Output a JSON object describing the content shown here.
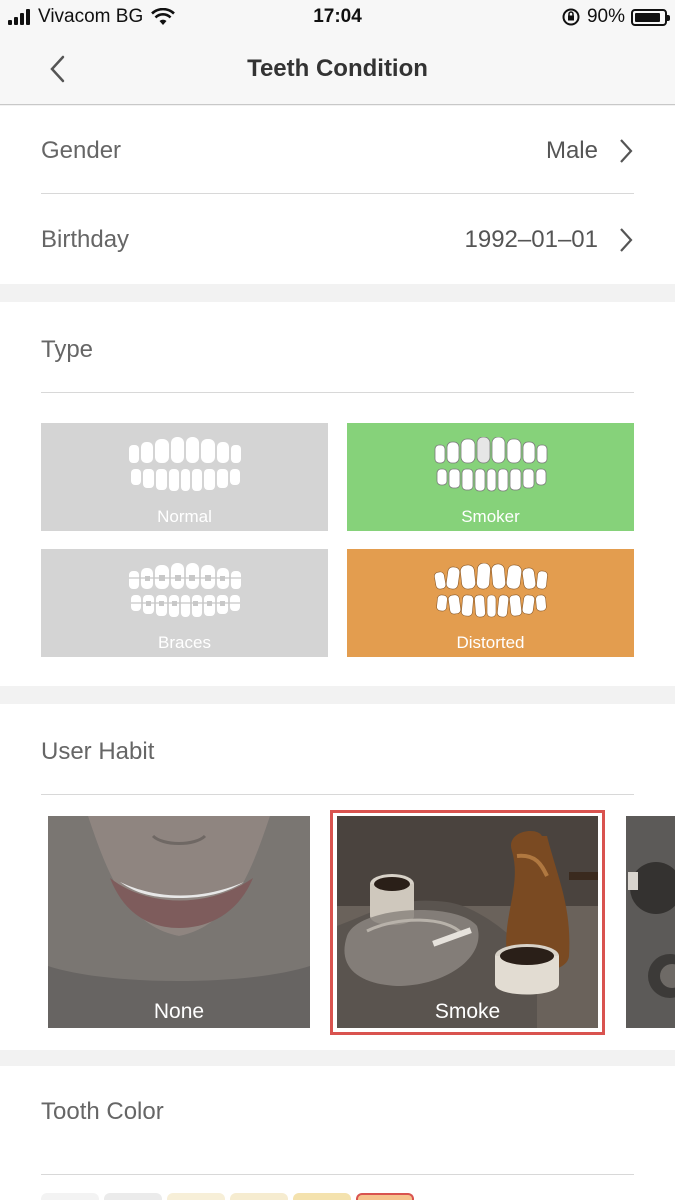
{
  "status": {
    "carrier": "Vivacom BG",
    "time": "17:04",
    "battery": "90%",
    "battery_level": 0.9
  },
  "nav": {
    "title": "Teeth Condition"
  },
  "profile": {
    "gender_label": "Gender",
    "gender_value": "Male",
    "birthday_label": "Birthday",
    "birthday_value": "1992–01–01"
  },
  "type_section": {
    "title": "Type",
    "tiles": [
      {
        "label": "Normal",
        "color": "#d4d4d4"
      },
      {
        "label": "Smoker",
        "color": "#86d27a"
      },
      {
        "label": "Braces",
        "color": "#d4d4d4"
      },
      {
        "label": "Distorted",
        "color": "#e39d4f"
      }
    ]
  },
  "habit_section": {
    "title": "User Habit",
    "cards": [
      {
        "label": "None",
        "selected": false
      },
      {
        "label": "Smoke",
        "selected": true
      }
    ],
    "selected_color": "#d9534f"
  },
  "tooth_color_section": {
    "title": "Tooth Color",
    "swatches": [
      "#f3f3f3",
      "#ebebeb",
      "#f7efd8",
      "#f6ecd0",
      "#f4e2ae",
      "#f6c38e"
    ]
  },
  "icons": {
    "back": "chevron-left-icon",
    "chevron": "chevron-right-icon",
    "wifi": "wifi-icon",
    "lock": "orientation-lock-icon"
  }
}
